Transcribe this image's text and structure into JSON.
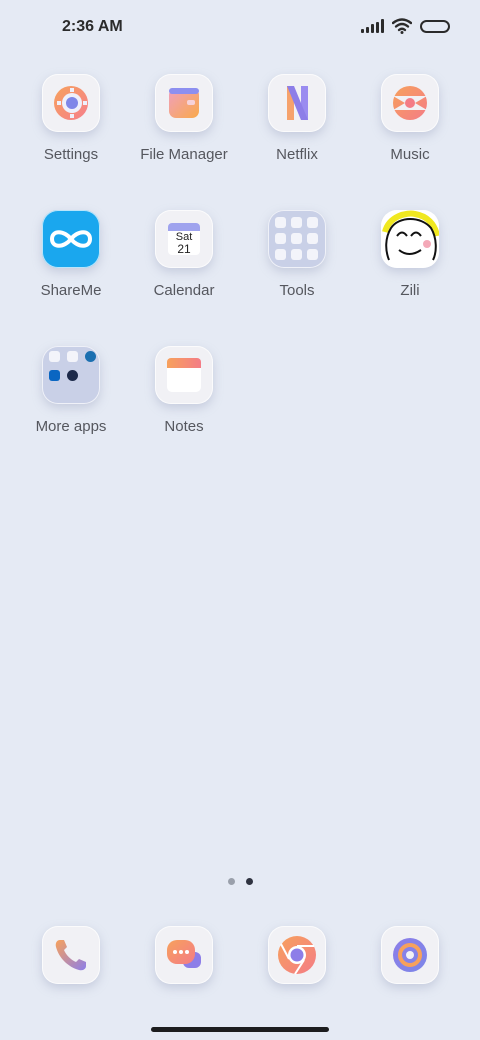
{
  "status": {
    "time": "2:36 AM"
  },
  "apps": [
    {
      "label": "Settings"
    },
    {
      "label": "File Manager"
    },
    {
      "label": "Netflix"
    },
    {
      "label": "Music"
    },
    {
      "label": "ShareMe"
    },
    {
      "label": "Calendar",
      "day": "Sat",
      "date": "21"
    },
    {
      "label": "Tools"
    },
    {
      "label": "Zili"
    },
    {
      "label": "More apps"
    },
    {
      "label": "Notes"
    }
  ],
  "dock": [
    {
      "icon": "phone-icon"
    },
    {
      "icon": "messages-icon"
    },
    {
      "icon": "chrome-icon"
    },
    {
      "icon": "browser-icon"
    }
  ],
  "pages": {
    "count": 2,
    "active": 2
  }
}
